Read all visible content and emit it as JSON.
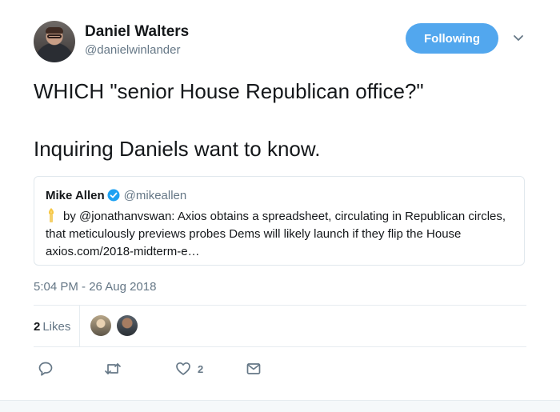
{
  "tweet": {
    "author": {
      "display_name": "Daniel Walters",
      "screen_name": "@danielwinlander"
    },
    "follow_button": {
      "label": "Following"
    },
    "text_lines": [
      "WHICH \"senior House Republican office?\"",
      "Inquiring Daniels want to know."
    ],
    "quoted": {
      "display_name": "Mike Allen",
      "screen_name": "@mikeallen",
      "text": "by @jonathanvswan: Axios obtains a spreadsheet, circulating in Republican circles, that meticulously previews probes Dems will likely launch if they flip the House axios.com/2018-midterm-e…"
    },
    "timestamp": "5:04 PM - 26 Aug 2018",
    "stats": {
      "likes_count": "2",
      "likes_label": "Likes"
    },
    "actions": {
      "like_count": "2"
    }
  },
  "colors": {
    "accent": "#52a7ee",
    "text": "#14171a",
    "secondary_text": "#657786",
    "border": "#e1e8ed"
  },
  "icons": [
    "avatar",
    "chevron-down-icon",
    "verified-icon",
    "torch-emoji",
    "reply-icon",
    "retweet-icon",
    "heart-icon",
    "mail-icon"
  ]
}
